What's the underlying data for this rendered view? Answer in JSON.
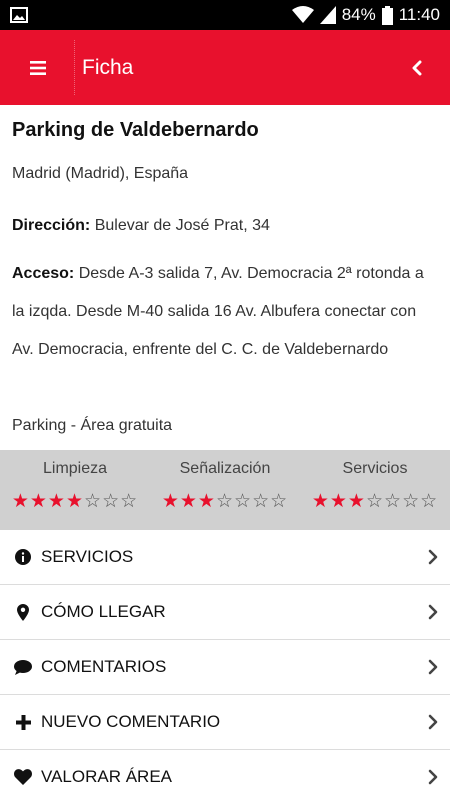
{
  "status_bar": {
    "battery": "84%",
    "time": "11:40"
  },
  "app_bar": {
    "title": "Ficha"
  },
  "place": {
    "name": "Parking de Valdebernardo",
    "location": "Madrid (Madrid), España",
    "address_label": "Dirección:",
    "address": "Bulevar de José Prat, 34",
    "access_label": "Acceso:",
    "access": "Desde A-3 salida 7, Av. Democracia 2ª rotonda a la izqda. Desde M-40 salida 16 Av. Albufera conectar con Av. Democracia, enfrente del C. C. de Valdebernardo",
    "category": "Parking - Área gratuita"
  },
  "ratings": [
    {
      "label": "Limpieza",
      "stars": 4,
      "max": 7
    },
    {
      "label": "Señalización",
      "stars": 3,
      "max": 7
    },
    {
      "label": "Servicios",
      "stars": 3,
      "max": 7
    }
  ],
  "menu": [
    {
      "label": "SERVICIOS",
      "icon": "info-icon"
    },
    {
      "label": "CÓMO LLEGAR",
      "icon": "map-pin-icon"
    },
    {
      "label": "COMENTARIOS",
      "icon": "comment-icon"
    },
    {
      "label": "NUEVO COMENTARIO",
      "icon": "plus-icon"
    },
    {
      "label": "VALORAR ÁREA",
      "icon": "heart-icon"
    }
  ],
  "colors": {
    "accent": "#e8112d",
    "ratings_bg": "#d0d0d0"
  }
}
